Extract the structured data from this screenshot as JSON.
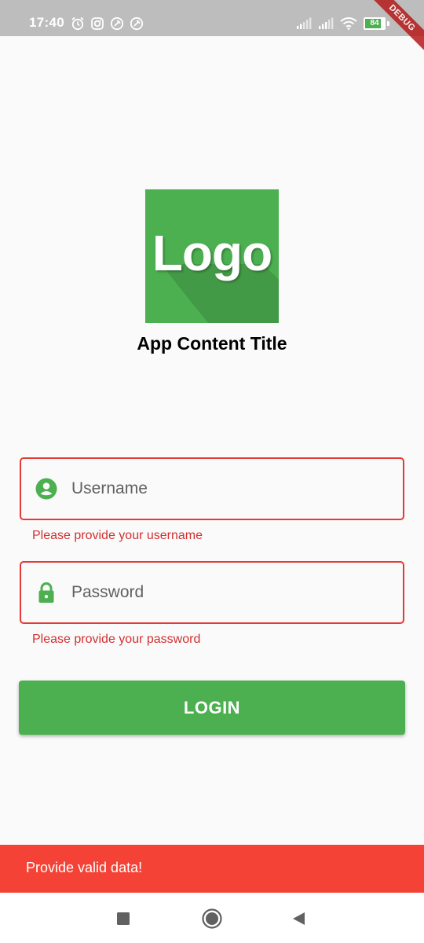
{
  "status_bar": {
    "time": "17:40",
    "battery_level": "84",
    "left_icons": [
      "alarm-icon",
      "instagram-icon",
      "app-notification-icon",
      "app-notification-icon"
    ],
    "right_icons": [
      "signal-icon",
      "signal-icon",
      "wifi-icon",
      "battery-icon"
    ]
  },
  "debug_banner": "DEBUG",
  "logo": {
    "text": "Logo",
    "color": "#4caf50"
  },
  "app_title": "App Content Title",
  "form": {
    "username": {
      "placeholder": "Username",
      "value": "",
      "icon": "account-circle-icon",
      "error": "Please provide your username"
    },
    "password": {
      "placeholder": "Password",
      "value": "",
      "icon": "lock-icon",
      "error": "Please provide your password"
    },
    "login_label": "LOGIN"
  },
  "snackbar": {
    "message": "Provide valid data!",
    "color": "#f44336"
  },
  "nav_bar": {
    "buttons": [
      "recents-icon",
      "home-icon",
      "back-icon"
    ]
  },
  "colors": {
    "accent": "#4caf50",
    "error": "#d32f2f",
    "error_border": "#e53935"
  }
}
